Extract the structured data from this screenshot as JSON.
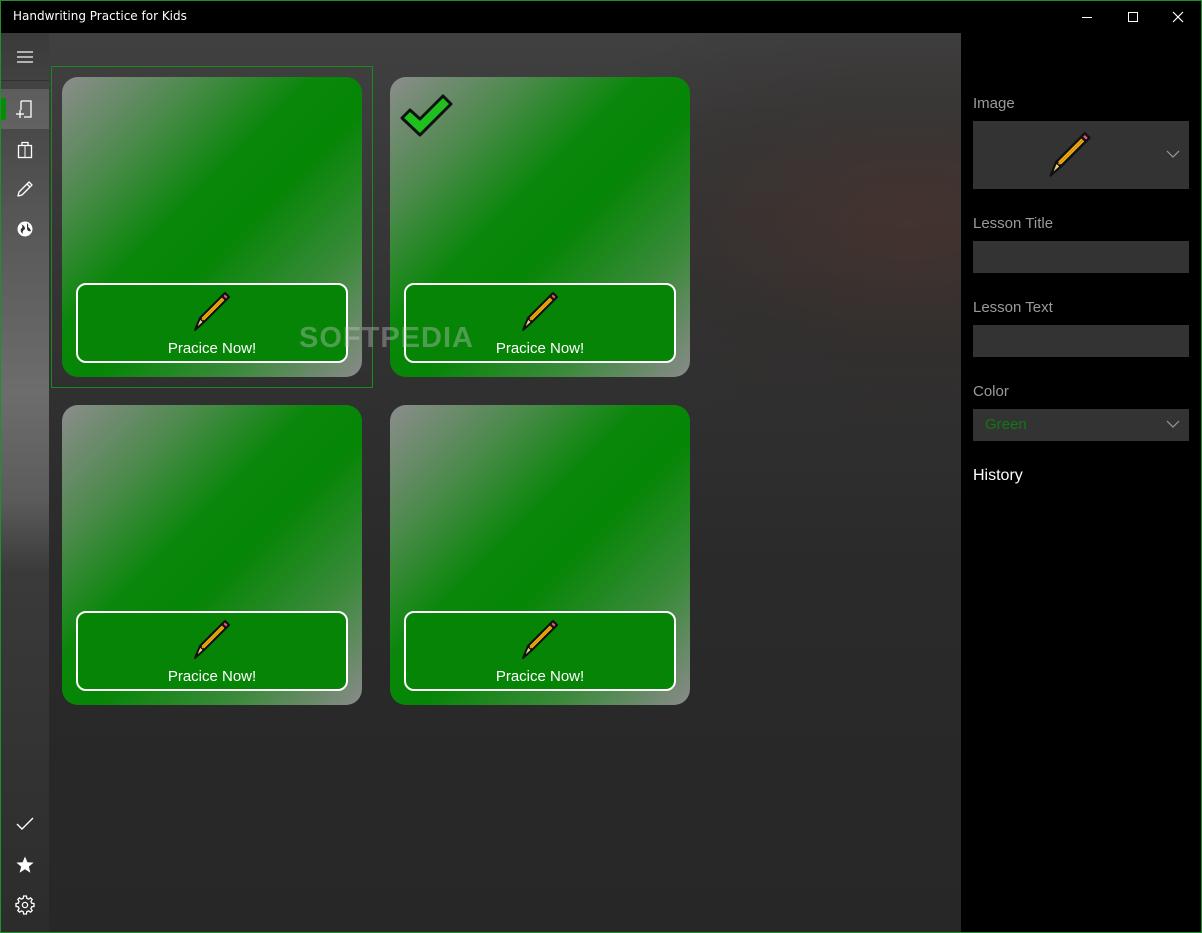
{
  "window": {
    "title": "Handwriting Practice for Kids"
  },
  "nav": {
    "items": [
      {
        "id": "menu",
        "icon": "hamburger-icon"
      },
      {
        "id": "lessons",
        "icon": "add-page-icon",
        "selected": true
      },
      {
        "id": "store",
        "icon": "shopping-bag-icon"
      },
      {
        "id": "draw",
        "icon": "pencil-icon"
      },
      {
        "id": "web",
        "icon": "globe-icon"
      },
      {
        "id": "completed",
        "icon": "checkmark-icon"
      },
      {
        "id": "favorites",
        "icon": "star-icon"
      },
      {
        "id": "settings",
        "icon": "gear-icon"
      }
    ]
  },
  "lessons": [
    {
      "button_label": "Pracice Now!",
      "completed": false,
      "selected": true,
      "icon": "pencil-icon"
    },
    {
      "button_label": "Pracice Now!",
      "completed": true,
      "selected": false,
      "icon": "pencil-icon"
    },
    {
      "button_label": "Pracice Now!",
      "completed": false,
      "selected": false,
      "icon": "pencil-icon"
    },
    {
      "button_label": "Pracice Now!",
      "completed": false,
      "selected": false,
      "icon": "pencil-icon"
    }
  ],
  "watermark": "SOFTPEDIA",
  "panel": {
    "image_label": "Image",
    "image_value_icon": "pencil-icon",
    "lesson_title_label": "Lesson Title",
    "lesson_title_value": "",
    "lesson_text_label": "Lesson Text",
    "lesson_text_value": "",
    "color_label": "Color",
    "color_value": "Green",
    "history_label": "History"
  },
  "colors": {
    "accent": "#058405",
    "window_border": "#1f8f2f",
    "panel_bg": "#000000",
    "input_bg": "#333333"
  }
}
